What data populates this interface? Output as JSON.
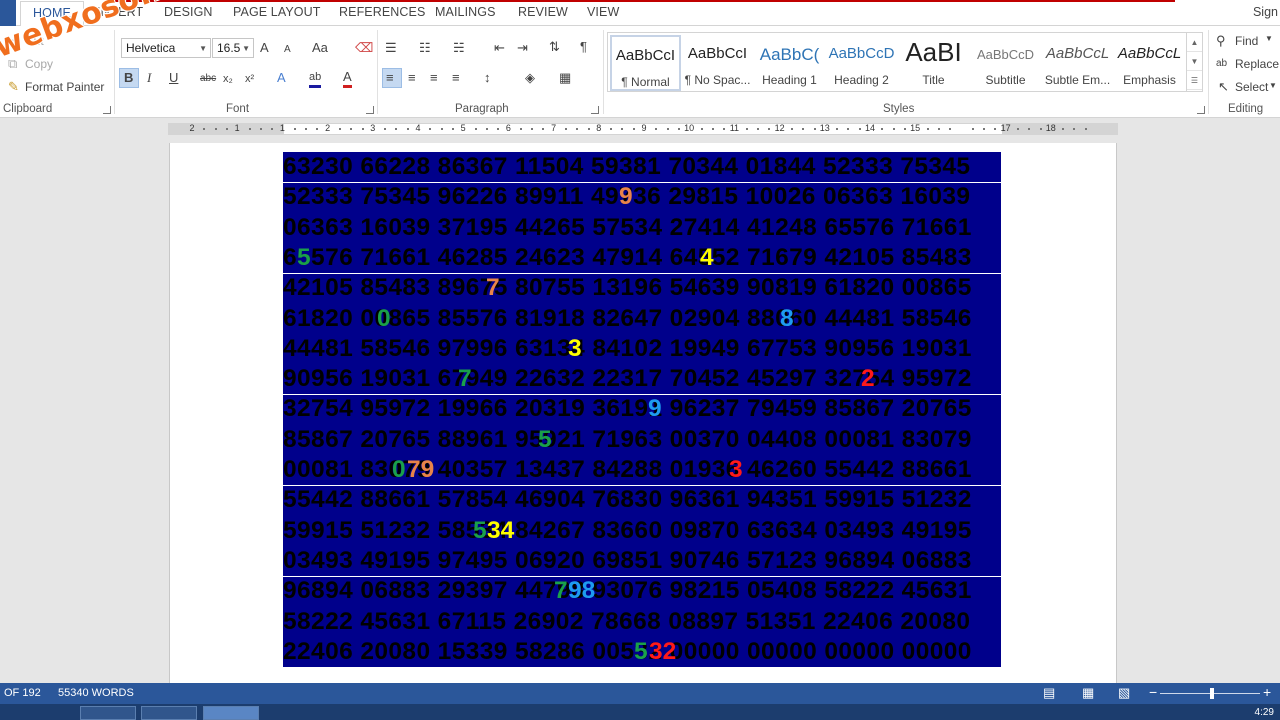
{
  "watermark": "webxoso.net",
  "tabs": {
    "home": "HOME",
    "insert": "INSERT",
    "design": "DESIGN",
    "page_layout": "PAGE LAYOUT",
    "references": "REFERENCES",
    "mailings": "MAILINGS",
    "review": "REVIEW",
    "view": "VIEW",
    "sign_in": "Sign"
  },
  "clipboard": {
    "cut": "Cut",
    "copy": "Copy",
    "format_painter": "Format Painter",
    "label": "Clipboard"
  },
  "font": {
    "name": "Helvetica",
    "size": "16.5",
    "label": "Font",
    "bold": "B",
    "italic": "I",
    "underline": "U",
    "strike": "abc",
    "subscript": "x₂",
    "superscript": "x²",
    "grow": "A",
    "shrink": "A",
    "case": "Aa",
    "text_effects": "A",
    "highlight": "ab",
    "font_color": "A"
  },
  "paragraph": {
    "label": "Paragraph",
    "pilcrow": "¶"
  },
  "styles": {
    "label": "Styles",
    "items": [
      {
        "preview": "AaBbCcI",
        "name": "¶ Normal"
      },
      {
        "preview": "AaBbCcI",
        "name": "¶ No Spac..."
      },
      {
        "preview": "AaBbC(",
        "name": "Heading 1"
      },
      {
        "preview": "AaBbCcD",
        "name": "Heading 2"
      },
      {
        "preview": "AaBI",
        "name": "Title"
      },
      {
        "preview": "AaBbCcD",
        "name": "Subtitle"
      },
      {
        "preview": "AaBbCcL",
        "name": "Subtle Em..."
      },
      {
        "preview": "AaBbCcL",
        "name": "Emphasis"
      }
    ]
  },
  "editing": {
    "find": "Find",
    "replace": "Replace",
    "select": "Select",
    "label": "Editing"
  },
  "ruler": {
    "numbers": [
      "2",
      "1",
      "1",
      "2",
      "3",
      "4",
      "5",
      "6",
      "7",
      "8",
      "9",
      "10",
      "11",
      "12",
      "13",
      "14",
      "15",
      "",
      "17",
      "18"
    ]
  },
  "document": {
    "lines": [
      "63230 66228 86367 11504 59381 70344 01844 52333 75345",
      "52333 75345 96226 89911 49736 29815 10026 06363 16039",
      "06363 16039 37195 44265 57534 27414 41248 65576 71661",
      "65576 71661 46285 24623 47914 64552 71679 42105 85483",
      "42105 85483 89675 80755 13196 54639 90819 61820 00865",
      "61820 00865 85576 81918 82647 02904 88060 44481 58546",
      "44481 58546 97996 63134 84102 19949 67753 90956 19031",
      "90956 19031 67949 22632 22317 70452 45297 32754 95972",
      "32754 95972 19966 20319 36191 96237 79459 85867 20765",
      "85867 20765 88961 95921 71963 00370 04408 00081 83079",
      "00081 83079 40357 13437 84288 01936 46260 55442 88661",
      "55442 88661 57854 46904 76830 96361 94351 59915 51232",
      "59915 51232 58534 84267 83660 09870 63634 03493 49195",
      "03493 49195 97495 06920 69851 90746 57123 96894 06883",
      "96894 06883 29397 44798 93076 98215 05408 58222 45631",
      "58222 45631 67115 26902 78668 08897 51351 22406 20080",
      "22406 20080 15339 58286 00532 00000 00000 00000 00000"
    ],
    "highlights": [
      {
        "text": "9",
        "color": "#e8844a"
      },
      {
        "text": "5",
        "color": "#1aa04a"
      },
      {
        "text": "4",
        "color": "#ffff00"
      },
      {
        "text": "7",
        "color": "#e8844a"
      },
      {
        "text": "0",
        "color": "#1aa04a"
      },
      {
        "text": "8",
        "color": "#1e9bf0"
      },
      {
        "text": "3",
        "color": "#ffff00"
      },
      {
        "text": "7",
        "color": "#1aa04a"
      },
      {
        "text": "2",
        "color": "#ff1a1a"
      },
      {
        "text": "9",
        "color": "#1e9bf0"
      },
      {
        "text": "5",
        "color": "#1aa04a"
      },
      {
        "text": "0",
        "color": "#1aa04a"
      },
      {
        "text": "79",
        "color": "#e8844a"
      },
      {
        "text": "3",
        "color": "#ff1a1a"
      },
      {
        "text": "5",
        "color": "#1aa04a"
      },
      {
        "text": "34",
        "color": "#ffff00"
      },
      {
        "text": "7",
        "color": "#1aa04a"
      },
      {
        "text": "98",
        "color": "#1e9bf0"
      },
      {
        "text": "5",
        "color": "#1aa04a"
      },
      {
        "text": "32",
        "color": "#ff1a1a"
      }
    ]
  },
  "status": {
    "page": "OF 192",
    "words": "55340 WORDS"
  },
  "taskbar": {
    "clock": "4:29"
  },
  "colors": {
    "accent": "#2b579a",
    "table_bg": "#00008b"
  }
}
